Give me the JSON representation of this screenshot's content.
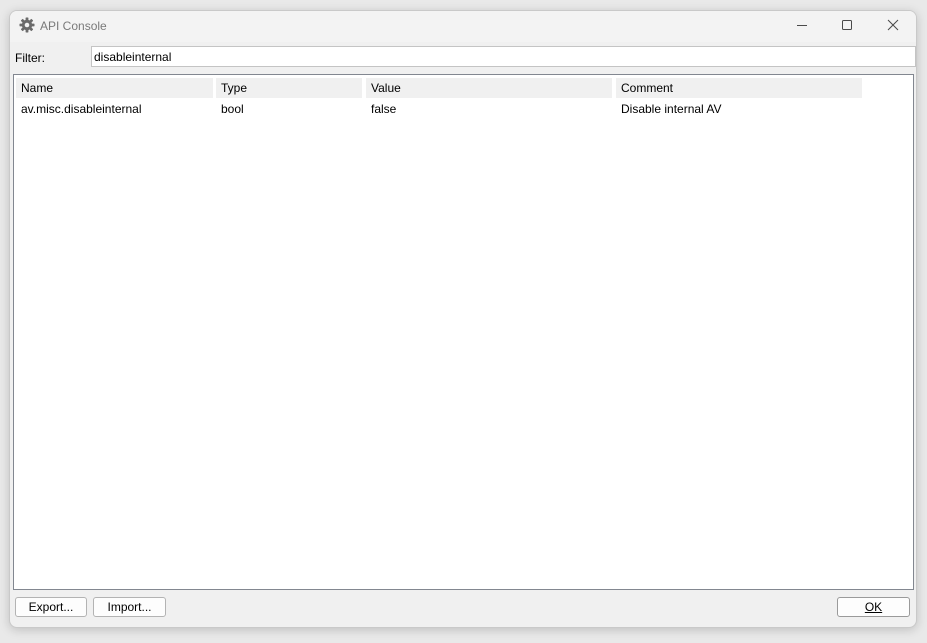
{
  "window": {
    "title": "API Console",
    "app_icon": "gear-icon",
    "controls": {
      "minimize_icon": "minimize-icon",
      "maximize_icon": "maximize-icon",
      "close_icon": "close-icon"
    }
  },
  "filter": {
    "label": "Filter:",
    "value": "disableinternal"
  },
  "table": {
    "columns": [
      "Name",
      "Type",
      "Value",
      "Comment"
    ],
    "rows": [
      {
        "name": "av.misc.disableinternal",
        "type": "bool",
        "value": "false",
        "comment": "Disable internal AV"
      }
    ]
  },
  "buttons": {
    "export_label": "Export...",
    "import_label": "Import...",
    "ok_label": "OK"
  }
}
